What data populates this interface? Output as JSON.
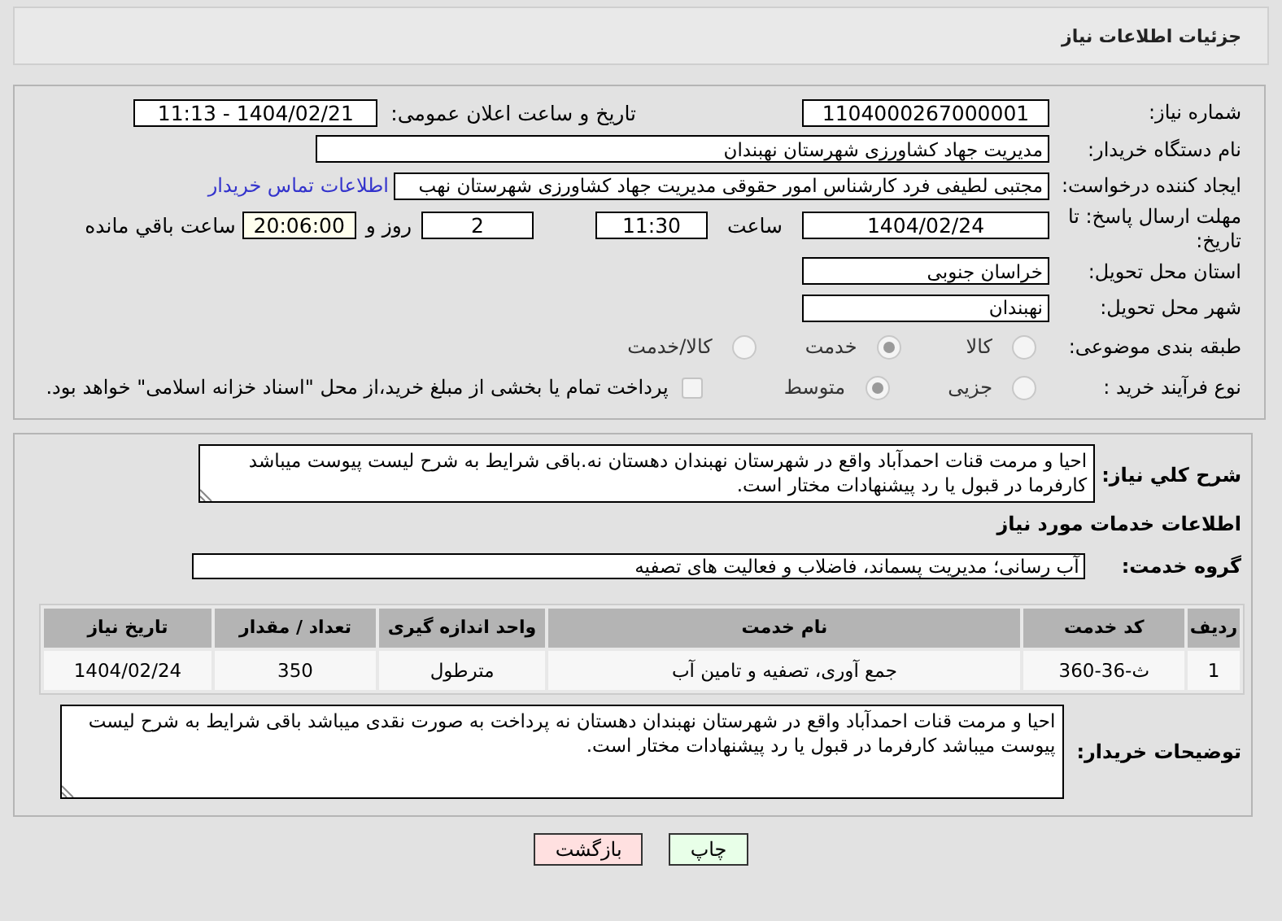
{
  "header": {
    "title": "جزئیات اطلاعات نیاز"
  },
  "need_number": {
    "label": "شماره نیاز:",
    "value": "1104000267000001"
  },
  "announce": {
    "label": "تاریخ و ساعت اعلان عمومی:",
    "value": "1404/02/21 - 11:13"
  },
  "buyer": {
    "label": "نام دستگاه خریدار:",
    "value": "مدیریت جهاد کشاورزی شهرستان نهبندان"
  },
  "requester": {
    "label": "ایجاد کننده درخواست:",
    "value": "مجتبی لطیفی فرد کارشناس امور حقوقی مدیریت جهاد کشاورزی شهرستان نهب",
    "link": "اطلاعات تماس خریدار"
  },
  "deadline": {
    "label": "مهلت ارسال پاسخ: تا تاریخ:",
    "date": "1404/02/24",
    "time_label": "ساعت",
    "time": "11:30",
    "days": "2",
    "days_label": "روز و",
    "remaining": "20:06:00",
    "remaining_label": "ساعت باقي مانده"
  },
  "province": {
    "label": "استان محل تحویل:",
    "value": "خراسان جنوبی"
  },
  "city": {
    "label": "شهر محل تحویل:",
    "value": "نهبندان"
  },
  "category": {
    "label": "طبقه بندی موضوعی:",
    "options": [
      {
        "label": "کالا",
        "selected": false
      },
      {
        "label": "خدمت",
        "selected": true
      },
      {
        "label": "کالا/خدمت",
        "selected": false
      }
    ]
  },
  "process": {
    "label": "نوع فرآیند خرید :",
    "options": [
      {
        "label": "جزیی",
        "selected": false
      },
      {
        "label": "متوسط",
        "selected": true
      }
    ],
    "treasury": {
      "checked": false,
      "text": "پرداخت تمام یا بخشی از مبلغ خرید،از محل \"اسناد خزانه اسلامی\" خواهد بود."
    }
  },
  "summary": {
    "label": "شرح کلي نیاز:",
    "text": "احیا و مرمت قنات احمدآباد واقع در شهرستان نهبندان دهستان نه.باقی شرایط به شرح لیست پیوست میباشد کارفرما در قبول یا رد پیشنهادات مختار است."
  },
  "services_heading": "اطلاعات خدمات مورد نیاز",
  "service_group": {
    "label": "گروه خدمت:",
    "value": "آب رسانی؛ مدیریت پسماند، فاضلاب و فعالیت های تصفیه"
  },
  "table": {
    "columns": [
      "ردیف",
      "کد خدمت",
      "نام خدمت",
      "واحد اندازه گیری",
      "تعداد / مقدار",
      "تاریخ نیاز"
    ],
    "rows": [
      [
        "1",
        "ث-36-360",
        "جمع آوری، تصفیه و تامین آب",
        "مترطول",
        "350",
        "1404/02/24"
      ]
    ]
  },
  "buyer_notes": {
    "label": "توضیحات خریدار:",
    "text": "احیا و مرمت قنات احمدآباد واقع در شهرستان نهبندان دهستان نه پرداخت  به صورت نقدی میباشد باقی شرایط به شرح لیست پیوست میباشد کارفرما در قبول یا رد پیشنهادات مختار است."
  },
  "buttons": [
    {
      "label": "چاپ",
      "kind": "print"
    },
    {
      "label": "بازگشت",
      "kind": "back"
    }
  ]
}
